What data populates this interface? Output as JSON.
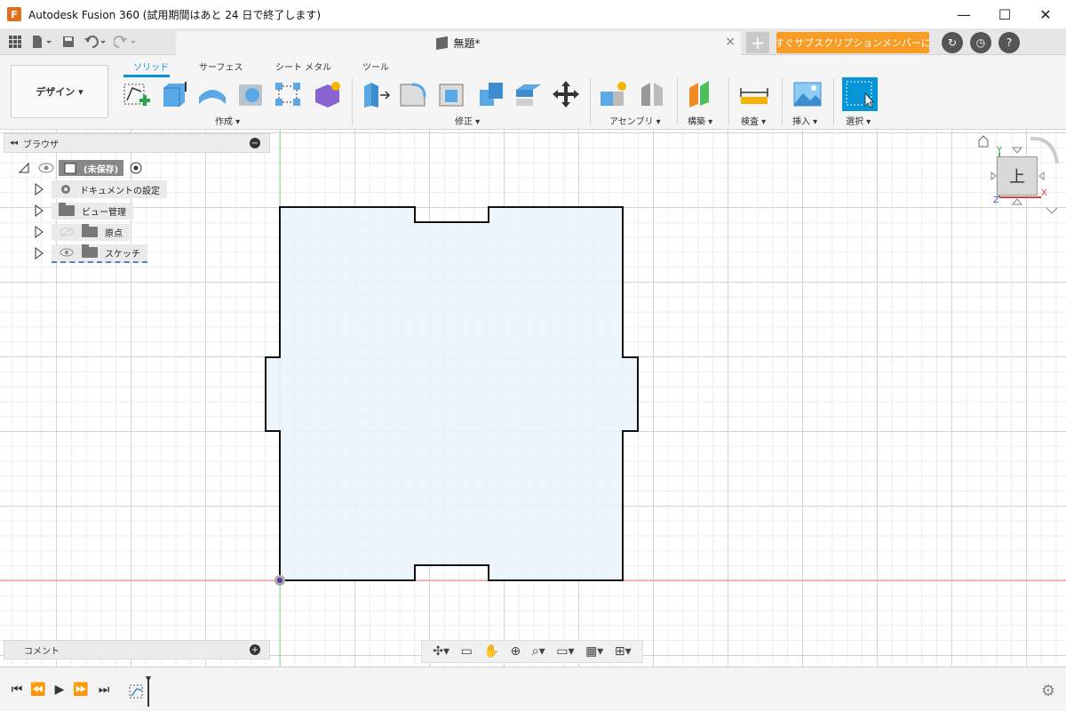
{
  "window": {
    "title": "Autodesk Fusion 360 (試用期間はあと 24 日で終了します)",
    "logo_letter": "F",
    "minimize": "—",
    "maximize": "☐",
    "close": "✕"
  },
  "tabbar": {
    "doc_title": "無題*",
    "close_glyph": "×",
    "new_tab_glyph": "+",
    "subscribe_label": "今すぐサブスクリプションメンバーに…",
    "quick_access": [
      "grid-icon",
      "file-icon",
      "save-icon",
      "undo-icon",
      "redo-icon"
    ]
  },
  "ribbon": {
    "workspace_label": "デザイン ▾",
    "tabs": [
      "ソリッド",
      "サーフェス",
      "シート メタル",
      "ツール"
    ],
    "active_tab": "ソリッド",
    "groups": {
      "create": "作成 ▾",
      "modify": "修正 ▾",
      "assemble": "アセンブリ ▾",
      "construct": "構築 ▾",
      "inspect": "検査 ▾",
      "insert": "挿入 ▾",
      "select": "選択 ▾"
    },
    "accent": "#0696d7"
  },
  "browser": {
    "title": "ブラウザ",
    "root": "(未保存)",
    "items": [
      "ドキュメントの設定",
      "ビュー管理",
      "原点",
      "スケッチ"
    ]
  },
  "comments": {
    "title": "コメント"
  },
  "viewcube": {
    "face_label": "上",
    "axis_y": "Y",
    "axis_x": "X",
    "axis_z": "Z"
  },
  "colors": {
    "sketch_fill": "#e8f3fa",
    "sketch_stroke": "#111111",
    "x_axis": "#f08080",
    "y_axis": "#90e090",
    "subscribe": "#f79c24"
  }
}
